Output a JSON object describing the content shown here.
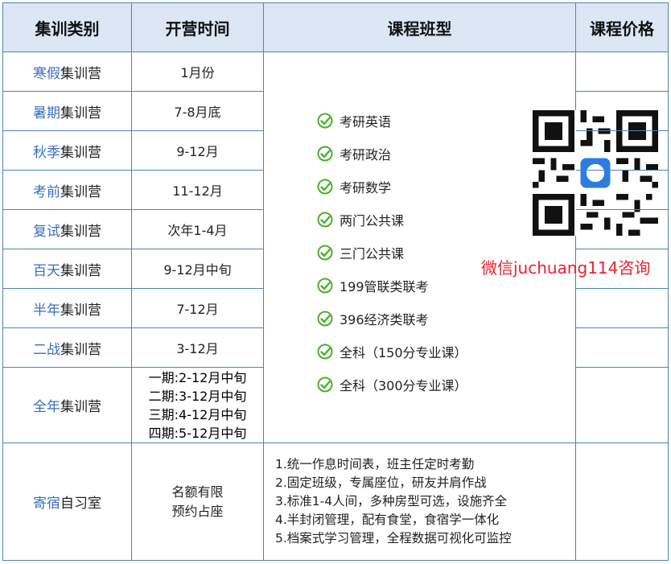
{
  "headers": {
    "category": "集训类别",
    "time": "开营时间",
    "course": "课程班型",
    "price": "课程价格"
  },
  "rows": [
    {
      "hl": "寒假",
      "rest": "集训营",
      "time": "1月份"
    },
    {
      "hl": "暑期",
      "rest": "集训营",
      "time": "7-8月底"
    },
    {
      "hl": "秋季",
      "rest": "集训营",
      "time": "9-12月"
    },
    {
      "hl": "考前",
      "rest": "集训营",
      "time": "11-12月"
    },
    {
      "hl": "复试",
      "rest": "集训营",
      "time": "次年1-4月"
    },
    {
      "hl": "百天",
      "rest": "集训营",
      "time": "9-12月中旬"
    },
    {
      "hl": "半年",
      "rest": "集训营",
      "time": "7-12月"
    },
    {
      "hl": "二战",
      "rest": "集训营",
      "time": "3-12月"
    }
  ],
  "fullyear": {
    "hl": "全年",
    "rest": "集训营",
    "periods": [
      "一期:2-12月中旬",
      "二期:3-12月中旬",
      "三期:4-12月中旬",
      "四期:5-12月中旬"
    ]
  },
  "courses": [
    "考研英语",
    "考研政治",
    "考研数学",
    "两门公共课",
    "三门公共课",
    "199管联类联考",
    "396经济类联考",
    "全科（150分专业课）",
    "全科（300分专业课）"
  ],
  "wechat_text": "微信juchuang114咨询",
  "dorm": {
    "hl": "寄宿",
    "rest": "自习室",
    "time_lines": [
      "名额有限",
      "预约占座"
    ],
    "features": [
      "1.统一作息时间表，班主任定时考勤",
      "2.固定班级，专属座位，研友并肩作战",
      "3.标准1-4人间，多种房型可选，设施齐全",
      "4.半封闭管理，配有食堂，食宿学一体化",
      "5.档案式学习管理，全程数据可视化可监控"
    ]
  },
  "colors": {
    "border": "#4f81bd",
    "header_bg": "#dce6f4",
    "highlight_text": "#3b6fb8",
    "check_green": "#4caf2e",
    "wechat_red": "#e8232f"
  }
}
